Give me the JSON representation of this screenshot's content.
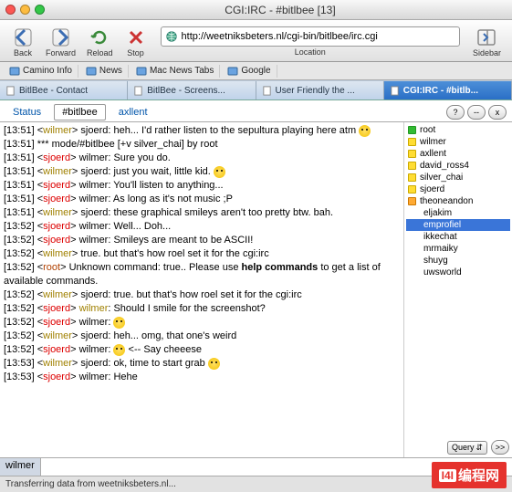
{
  "window": {
    "title": "CGI:IRC - #bitlbee [13]"
  },
  "toolbar": {
    "back": "Back",
    "forward": "Forward",
    "reload": "Reload",
    "stop": "Stop",
    "location_label": "Location",
    "sidebar": "Sidebar",
    "url": "http://weetniksbeters.nl/cgi-bin/bitlbee/irc.cgi"
  },
  "bookmarks": [
    "Camino Info",
    "News",
    "Mac News Tabs",
    "Google"
  ],
  "tabs": [
    {
      "label": "BitlBee - Contact",
      "active": false
    },
    {
      "label": "BitlBee - Screens...",
      "active": false
    },
    {
      "label": "User Friendly the ...",
      "active": false
    },
    {
      "label": "CGI:IRC - #bitlb...",
      "active": true
    }
  ],
  "subtabs": [
    "Status",
    "#bitlbee",
    "axllent"
  ],
  "subtabs_active": 1,
  "help_buttons": [
    "?",
    "--",
    "x"
  ],
  "chat": [
    {
      "ts": "[13:51]",
      "nick": "wilmer",
      "cls": "nk-b",
      "text": "sjoerd: heh... I'd rather listen to the sepultura playing here atm ",
      "smiley": true,
      "cut": true
    },
    {
      "ts": "[13:51]",
      "plain": "*** mode/#bitlbee [+v silver_chai] by root"
    },
    {
      "ts": "[13:51]",
      "nick": "sjoerd",
      "cls": "nk-a",
      "text": "wilmer: Sure you do."
    },
    {
      "ts": "[13:51]",
      "nick": "wilmer",
      "cls": "nk-b",
      "text": "sjoerd: just you wait, little kid. ",
      "smiley": true
    },
    {
      "ts": "[13:51]",
      "nick": "sjoerd",
      "cls": "nk-a",
      "text": "wilmer: You'll listen to anything..."
    },
    {
      "ts": "[13:51]",
      "nick": "sjoerd",
      "cls": "nk-a",
      "text": "wilmer: As long as it's not music ;P"
    },
    {
      "ts": "[13:51]",
      "nick": "wilmer",
      "cls": "nk-b",
      "text": "sjoerd: these graphical smileys aren't too pretty btw. bah."
    },
    {
      "ts": "[13:52]",
      "nick": "sjoerd",
      "cls": "nk-a",
      "text": "wilmer: Well... Doh..."
    },
    {
      "ts": "[13:52]",
      "nick": "sjoerd",
      "cls": "nk-a",
      "text": "wilmer: Smileys are meant to be ASCII!"
    },
    {
      "ts": "[13:52]",
      "nick": "wilmer",
      "cls": "nk-b",
      "text": "true. but that's how roel set it for the cgi:irc"
    },
    {
      "ts": "[13:52]",
      "nick": "root",
      "cls": "nk-c",
      "html": "Unknown command: true.. Please use <b>help commands</b> to get a list of available commands."
    },
    {
      "ts": "[13:52]",
      "nick": "wilmer",
      "cls": "nk-b",
      "text": "sjoerd: true. but that's how roel set it for the cgi:irc"
    },
    {
      "ts": "[13:52]",
      "nick": "sjoerd",
      "cls": "nk-a",
      "html": "<span class='wm'>wilmer</span>: Should I smile for the screenshot?"
    },
    {
      "ts": "[13:52]",
      "nick": "sjoerd",
      "cls": "nk-a",
      "text": "wilmer: ",
      "smiley": true
    },
    {
      "ts": "[13:52]",
      "nick": "wilmer",
      "cls": "nk-b",
      "text": "sjoerd: heh... omg, that one's weird"
    },
    {
      "ts": "[13:52]",
      "nick": "sjoerd",
      "cls": "nk-a",
      "html": "wilmer: <span class='smiley'></span> <-- Say cheeese"
    },
    {
      "ts": "[13:53]",
      "nick": "wilmer",
      "cls": "nk-b",
      "text": "sjoerd: ok, time to start  grab ",
      "smiley": true
    },
    {
      "ts": "[13:53]",
      "nick": "sjoerd",
      "cls": "nk-a",
      "text": "wilmer: Hehe"
    }
  ],
  "users": [
    {
      "name": "root",
      "box": "g"
    },
    {
      "name": "wilmer",
      "box": "y"
    },
    {
      "name": "axllent",
      "box": "y"
    },
    {
      "name": "david_ross4",
      "box": "y"
    },
    {
      "name": "silver_chai",
      "box": "y"
    },
    {
      "name": "sjoerd",
      "box": "y"
    },
    {
      "name": "theoneandon",
      "box": "o"
    },
    {
      "name": "eljakim",
      "box": "n"
    },
    {
      "name": "emprofiel",
      "box": "n",
      "sel": true
    },
    {
      "name": "ikkechat",
      "box": "n"
    },
    {
      "name": "mrmaiky",
      "box": "n"
    },
    {
      "name": "shuyg",
      "box": "n"
    },
    {
      "name": "uwsworld",
      "box": "n"
    }
  ],
  "user_action": {
    "select": "Query",
    "go": ">>"
  },
  "input": {
    "nick": "wilmer",
    "value": ""
  },
  "statusbar": "Transferring data from weetniksbeters.nl...",
  "watermark": {
    "logo": "I4I",
    "text": "编程网"
  }
}
